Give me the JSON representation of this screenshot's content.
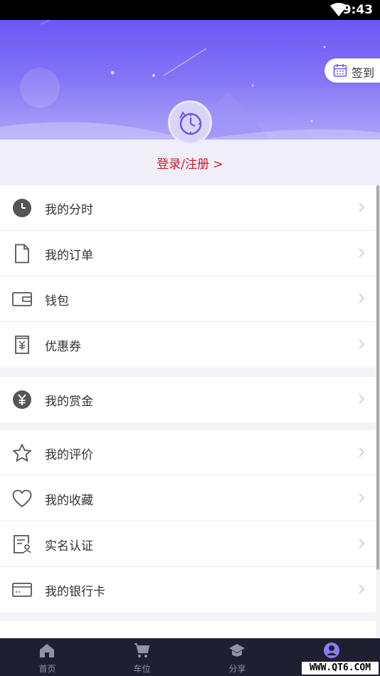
{
  "status_bar": {
    "time": "9:43"
  },
  "header": {
    "signin_label": "签到",
    "login_label": "登录/注册 >"
  },
  "menu_groups": [
    [
      {
        "label": "我的分时",
        "icon": "clock-icon"
      },
      {
        "label": "我的订单",
        "icon": "document-icon"
      },
      {
        "label": "钱包",
        "icon": "wallet-icon"
      },
      {
        "label": "优惠券",
        "icon": "coupon-icon"
      }
    ],
    [
      {
        "label": "我的赏金",
        "icon": "yen-coin-icon"
      }
    ],
    [
      {
        "label": "我的评价",
        "icon": "star-icon"
      },
      {
        "label": "我的收藏",
        "icon": "heart-icon"
      },
      {
        "label": "实名认证",
        "icon": "id-card-icon"
      },
      {
        "label": "我的银行卡",
        "icon": "bank-card-icon"
      }
    ]
  ],
  "tabs": [
    {
      "label": "首页",
      "icon": "home-icon"
    },
    {
      "label": "车位",
      "icon": "cart-icon"
    },
    {
      "label": "分享",
      "icon": "graduation-cap-icon"
    },
    {
      "label": "",
      "icon": "user-icon",
      "active": true
    }
  ],
  "watermark": "WWW.QT6.COM",
  "colors": {
    "accent": "#6c57f5",
    "login_link": "#d11a2a",
    "tabbar_bg": "#1e2031",
    "tab_active": "#8a7cf6"
  }
}
